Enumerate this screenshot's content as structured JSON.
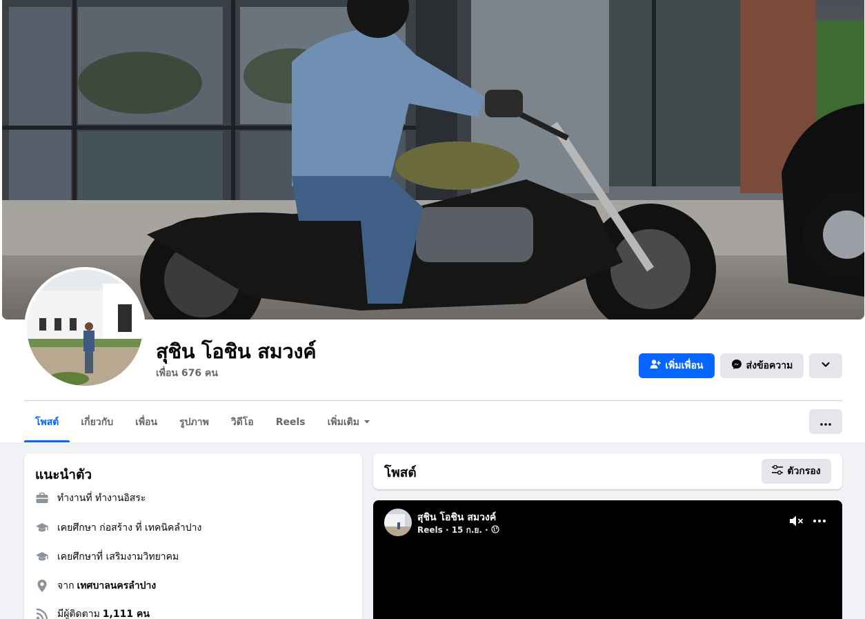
{
  "profile": {
    "name": "สุชิน โอชิน สมวงค์",
    "friends_text": "เพื่อน 676 คน"
  },
  "actions": {
    "add_friend": "เพิ่มเพื่อน",
    "message": "ส่งข้อความ"
  },
  "tabs": [
    {
      "label": "โพสต์",
      "active": true
    },
    {
      "label": "เกี่ยวกับ"
    },
    {
      "label": "เพื่อน"
    },
    {
      "label": "รูปภาพ"
    },
    {
      "label": "วิดีโอ"
    },
    {
      "label": "Reels"
    },
    {
      "label": "เพิ่มเติม"
    }
  ],
  "intro": {
    "title": "แนะนำตัว",
    "work": "ทำงานที่ ทำงานอิสระ",
    "edu1": "เคยศึกษา ก่อสร้าง ที่ เทคนิคลำปาง",
    "edu2": "เคยศึกษาที่ เสริมงามวิทยาคม",
    "from_prefix": "จาก",
    "from_place": "เทศบาลนครลำปาง",
    "followers_prefix": "มีผู้ติดตาม",
    "followers_count": "1,111 คน"
  },
  "posts": {
    "title": "โพสต์",
    "filter_label": "ตัวกรอง"
  },
  "reel": {
    "author": "สุชิน โอชิน สมวงค์",
    "meta": "Reels · 15 ก.ย. ·"
  },
  "colors": {
    "accent": "#0866ff",
    "secondary_button": "#e4e6eb",
    "page_bg": "#f0f2f5",
    "muted_text": "#65676b"
  }
}
